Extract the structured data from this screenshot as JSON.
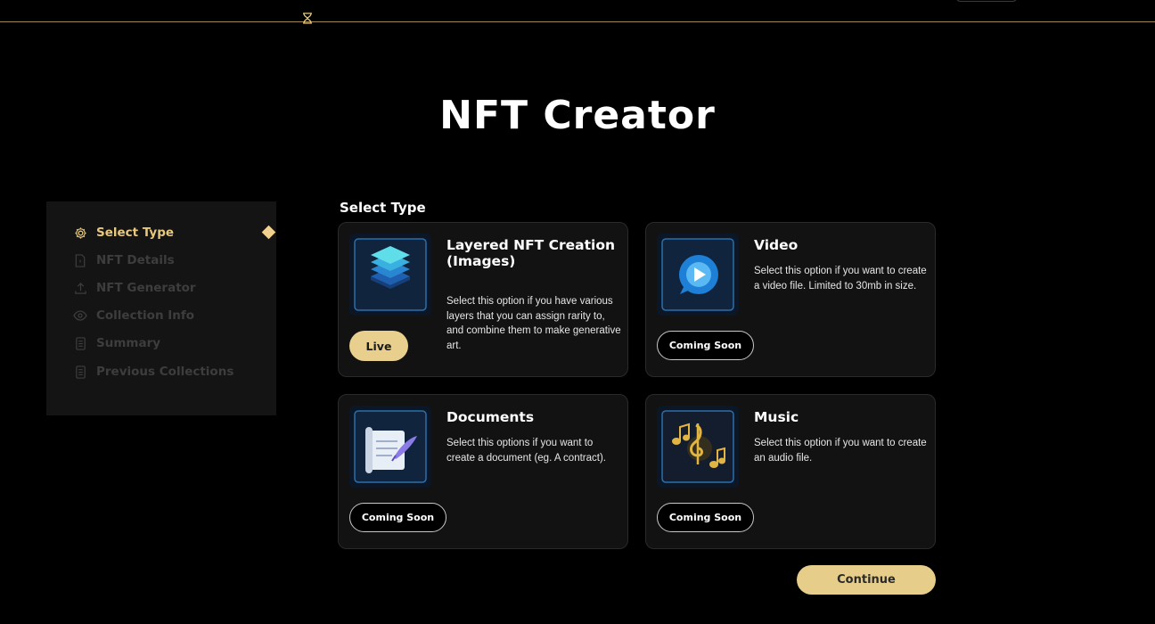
{
  "header": {
    "logo_icon": "hourglass-icon"
  },
  "page": {
    "title": "NFT Creator"
  },
  "sidebar": {
    "steps": [
      {
        "label": "Select Type",
        "icon": "gear-icon",
        "active": true
      },
      {
        "label": "NFT Details",
        "icon": "document-icon",
        "active": false
      },
      {
        "label": "NFT Generator",
        "icon": "upload-icon",
        "active": false
      },
      {
        "label": "Collection Info",
        "icon": "eye-icon",
        "active": false
      },
      {
        "label": "Summary",
        "icon": "list-document-icon",
        "active": false
      },
      {
        "label": "Previous Collections",
        "icon": "list-document-icon",
        "active": false
      }
    ]
  },
  "main": {
    "section_label": "Select Type",
    "cards": [
      {
        "title": "Layered NFT Creation (Images)",
        "description": "Select this option if you have various layers that you can assign rarity to, and combine them to make generative art.",
        "button": "Live",
        "image": "layers-icon"
      },
      {
        "title": "Video",
        "description": "Select this option if you want to create a video file. Limited to 30mb in size.",
        "button": "Coming Soon",
        "image": "play-video-icon"
      },
      {
        "title": "Documents",
        "description": "Select this options if you want to create a document (eg. A contract).",
        "button": "Coming Soon",
        "image": "scroll-quill-icon"
      },
      {
        "title": "Music",
        "description": "Select this option if you want to create an audio file.",
        "button": "Coming Soon",
        "image": "music-notes-icon"
      }
    ],
    "continue_label": "Continue"
  },
  "colors": {
    "accent_gold": "#e8c87a",
    "background": "#000000",
    "card": "#121212"
  }
}
